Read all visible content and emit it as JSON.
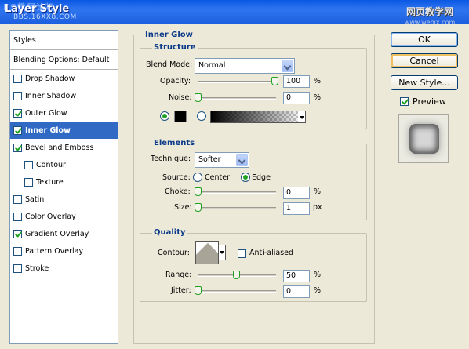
{
  "window": {
    "title": "Layer Style",
    "watermark_top": "PS教程论坛",
    "watermark_sub": "BBS.16XX8.COM",
    "watermark_right_cn": "网页教学网",
    "watermark_right_url": "www.webjx.com"
  },
  "styles_list": {
    "header": "Styles",
    "blending": "Blending Options: Default",
    "items": [
      {
        "label": "Drop Shadow",
        "checked": false
      },
      {
        "label": "Inner Shadow",
        "checked": false
      },
      {
        "label": "Outer Glow",
        "checked": true
      },
      {
        "label": "Inner Glow",
        "checked": true,
        "selected": true
      },
      {
        "label": "Bevel and Emboss",
        "checked": true
      },
      {
        "label": "Contour",
        "checked": false,
        "indent": true
      },
      {
        "label": "Texture",
        "checked": false,
        "indent": true
      },
      {
        "label": "Satin",
        "checked": false
      },
      {
        "label": "Color Overlay",
        "checked": false
      },
      {
        "label": "Gradient Overlay",
        "checked": true
      },
      {
        "label": "Pattern Overlay",
        "checked": false
      },
      {
        "label": "Stroke",
        "checked": false
      }
    ]
  },
  "inner_glow": {
    "title": "Inner Glow",
    "structure": {
      "title": "Structure",
      "blend_mode_label": "Blend Mode:",
      "blend_mode": "Normal",
      "opacity_label": "Opacity:",
      "opacity": "100",
      "noise_label": "Noise:",
      "noise": "0",
      "percent": "%"
    },
    "elements": {
      "title": "Elements",
      "technique_label": "Technique:",
      "technique": "Softer",
      "source_label": "Source:",
      "source_center": "Center",
      "source_edge": "Edge",
      "choke_label": "Choke:",
      "choke": "0",
      "size_label": "Size:",
      "size": "1",
      "px": "px",
      "percent": "%"
    },
    "quality": {
      "title": "Quality",
      "contour_label": "Contour:",
      "anti_aliased": "Anti-aliased",
      "range_label": "Range:",
      "range": "50",
      "jitter_label": "Jitter:",
      "jitter": "0",
      "percent": "%"
    }
  },
  "actions": {
    "ok": "OK",
    "cancel": "Cancel",
    "new_style": "New Style...",
    "preview": "Preview"
  }
}
